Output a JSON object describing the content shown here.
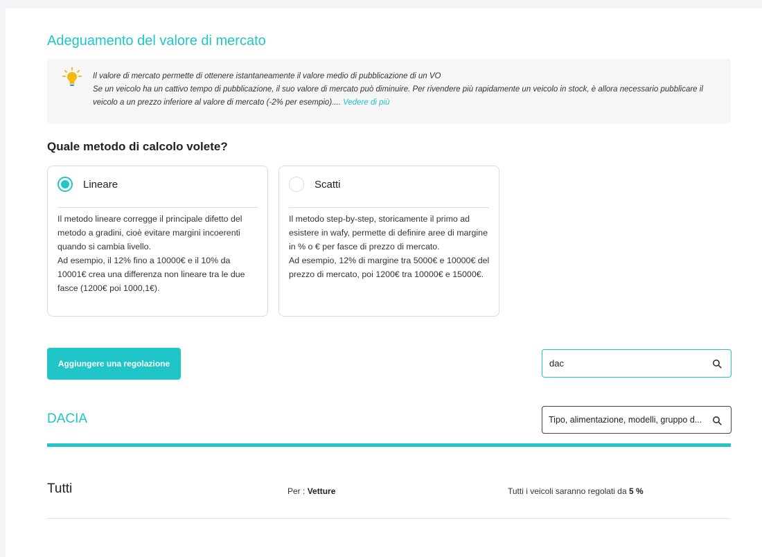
{
  "page": {
    "title": "Adeguamento del valore di mercato"
  },
  "info": {
    "icon": "lightbulb-icon",
    "line1": "Il valore di mercato permette di ottenere istantaneamente il valore medio di pubblicazione di un VO",
    "line2": "Se un veicolo ha un cattivo tempo di pubblicazione, il suo valore di mercato può diminuire. Per rivendere più rapidamente un veicolo in stock, è allora necessario pubblicare il veicolo a un prezzo inferiore al valore di mercato (-2% per esempio)....",
    "link": "Vedere di più"
  },
  "method": {
    "question": "Quale metodo di calcolo volete?",
    "options": [
      {
        "label": "Lineare",
        "selected": true,
        "description": "Il metodo lineare corregge il principale difetto del metodo a gradini, cioè evitare margini incoerenti quando si cambia livello.\nAd esempio, il 12% fino a 10000€ e il 10% da 10001€ crea una differenza non lineare tra le due fasce (1200€ poi 1000,1€)."
      },
      {
        "label": "Scatti",
        "selected": false,
        "description": "Il metodo step-by-step, storicamente il primo ad esistere in wafy, permette di definire aree di margine in % o € per fasce di prezzo di mercato.\nAd esempio, 12% di margine tra 5000€ e 10000€ del prezzo di mercato, poi 1200€ tra 10000€ e 15000€."
      }
    ]
  },
  "toolbar": {
    "add_label": "Aggiungere una regolazione",
    "search_value": "dac",
    "search_icon": "search-icon"
  },
  "brand": {
    "name": "DACIA",
    "filter_placeholder": "Tipo, alimentazione, modelli, gruppo d...",
    "filter_icon": "search-icon"
  },
  "rows": [
    {
      "name": "Tutti",
      "per_label": "Per : ",
      "per_value": "Vetture",
      "rule_prefix": "Tutti i veicoli saranno regolati da ",
      "rule_value": "5 %"
    }
  ],
  "colors": {
    "accent": "#1fc5c7",
    "info_bg": "#f6f6f6",
    "page_bg": "#f2f4f7",
    "bulb": "#f5b914"
  }
}
